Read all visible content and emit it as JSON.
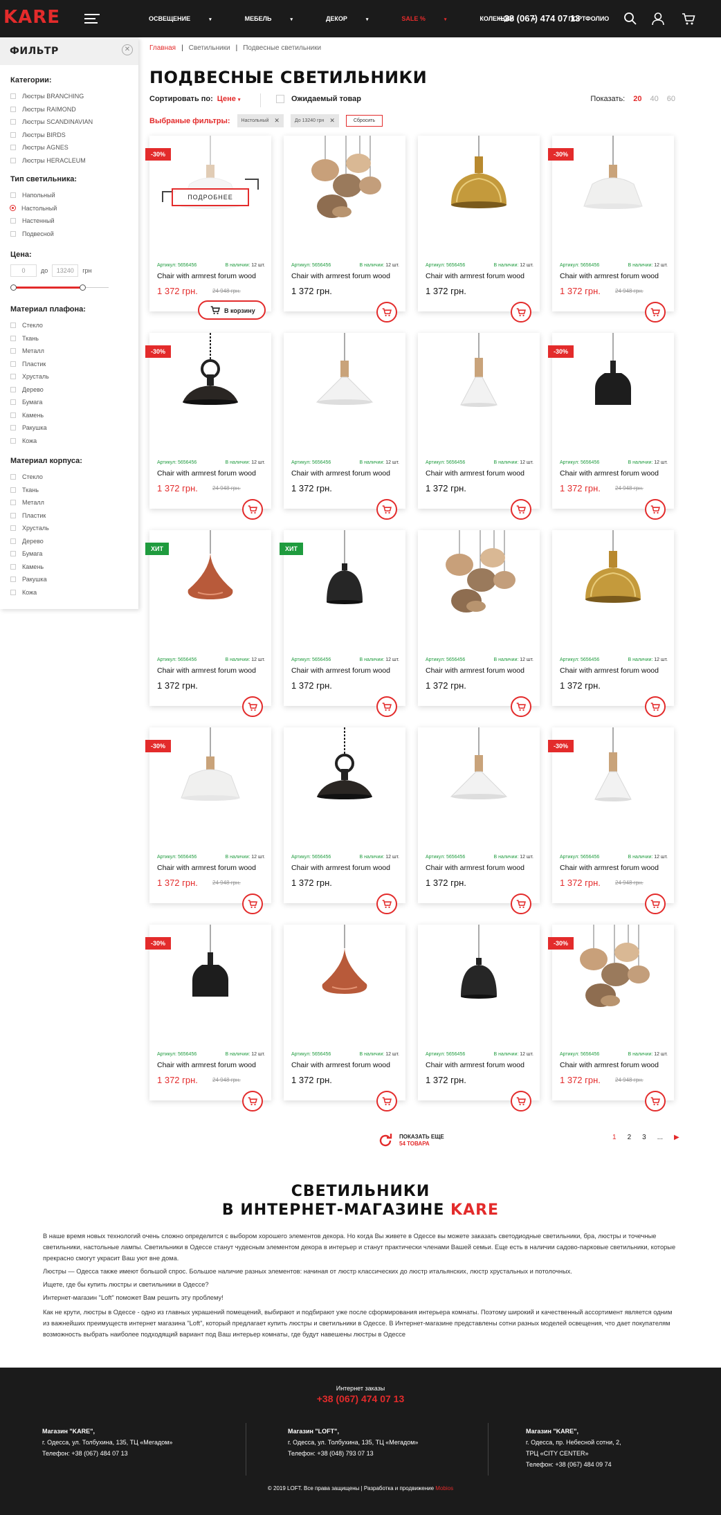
{
  "header": {
    "logo": "KARE",
    "nav": [
      {
        "label": "Освещение",
        "dropdown": true,
        "highlight": false
      },
      {
        "label": "Мебель",
        "dropdown": true,
        "highlight": false
      },
      {
        "label": "Декор",
        "dropdown": true,
        "highlight": false
      },
      {
        "label": "Sale %",
        "dropdown": true,
        "highlight": true
      },
      {
        "label": "Колекции",
        "dropdown": true,
        "highlight": false
      },
      {
        "label": "Портфолио",
        "dropdown": false,
        "highlight": false
      }
    ],
    "phone": "+38 (067) 474 07 13",
    "icons": [
      "search-icon",
      "user-icon",
      "cart-icon"
    ]
  },
  "filter": {
    "title": "ФИЛЬТР",
    "categories": {
      "title": "Категории:",
      "items": [
        "Люстры BRANCHING",
        "Люстры RAIMOND",
        "Люстры SCANDINAVIAN",
        "Люстры BIRDS",
        "Люстры AGNES",
        "Люстры HERACLEUM"
      ]
    },
    "lamp_type": {
      "title": "Тип светильника:",
      "items": [
        "Напольный",
        "Настольный",
        "Настенный",
        "Подвесной"
      ],
      "selected": "Настольный"
    },
    "price": {
      "title": "Цена:",
      "from": "0",
      "to": "13240",
      "to_label": "до",
      "currency": "грн"
    },
    "shade_material": {
      "title": "Материал плафона:",
      "items": [
        "Стекло",
        "Ткань",
        "Металл",
        "Пластик",
        "Хрусталь",
        "Дерево",
        "Бумага",
        "Камень",
        "Ракушка",
        "Кожа"
      ]
    },
    "body_material": {
      "title": "Материал корпуса:",
      "items": [
        "Стекло",
        "Ткань",
        "Металл",
        "Пластик",
        "Хрусталь",
        "Дерево",
        "Бумага",
        "Камень",
        "Ракушка",
        "Кожа"
      ]
    }
  },
  "breadcrumb": [
    "Главная",
    "Светильники",
    "Подвесные светильники"
  ],
  "page_title": "ПОДВЕСНЫЕ СВЕТИЛЬНИКИ",
  "sort": {
    "label": "Сортировать по:",
    "value": "Цене"
  },
  "expected": "Ожидаемый товар",
  "show": {
    "label": "Показать:",
    "options": [
      "20",
      "40",
      "60"
    ],
    "selected": "20"
  },
  "chosen_filters": {
    "label": "Выбраные фильтры:",
    "chips": [
      "Настольный",
      "До 13240 грн"
    ],
    "reset": "Сбросить"
  },
  "product_labels": {
    "sku": "Артикул: 5656456",
    "stock_prefix": "В наличии:",
    "stock_value": "12 шт.",
    "name": "Chair with armrest forum wood",
    "price": "1 372 грн.",
    "old_price": "24 948 грн.",
    "add_to_cart": "В корзину",
    "details": "ПОДРОБНЕЕ"
  },
  "products": [
    {
      "img": "white-bowl",
      "badge": "-30%",
      "sale": true,
      "hover": true
    },
    {
      "img": "amber-blobs",
      "badge": "",
      "sale": false
    },
    {
      "img": "gold-dome",
      "badge": "",
      "sale": false
    },
    {
      "img": "white-bowl",
      "badge": "-30%",
      "sale": true
    },
    {
      "img": "black-industrial",
      "badge": "-30%",
      "sale": true
    },
    {
      "img": "white-cone-wide",
      "badge": "",
      "sale": false
    },
    {
      "img": "white-cone-narrow",
      "badge": "",
      "sale": false
    },
    {
      "img": "black-cylinder",
      "badge": "-30%",
      "sale": true
    },
    {
      "img": "copper-onion",
      "badge": "ХИТ",
      "sale": false,
      "hit": true
    },
    {
      "img": "black-dome",
      "badge": "ХИТ",
      "sale": false,
      "hit": true
    },
    {
      "img": "amber-blobs",
      "badge": "",
      "sale": false
    },
    {
      "img": "gold-dome",
      "badge": "",
      "sale": false
    },
    {
      "img": "white-bowl",
      "badge": "-30%",
      "sale": true
    },
    {
      "img": "black-industrial",
      "badge": "",
      "sale": false
    },
    {
      "img": "white-cone-wide",
      "badge": "",
      "sale": false
    },
    {
      "img": "white-cone-narrow",
      "badge": "-30%",
      "sale": true
    },
    {
      "img": "black-cylinder",
      "badge": "-30%",
      "sale": true
    },
    {
      "img": "copper-onion",
      "badge": "",
      "sale": false
    },
    {
      "img": "black-dome",
      "badge": "",
      "sale": false
    },
    {
      "img": "amber-blobs",
      "badge": "-30%",
      "sale": true
    }
  ],
  "load_more": {
    "line1": "ПОКАЗАТЬ ЕЩЕ",
    "line2": "54 ТОВАРА"
  },
  "pagination": [
    "1",
    "2",
    "3",
    "..."
  ],
  "seo": {
    "title_line1": "СВЕТИЛЬНИКИ",
    "title_line2": "В ИНТЕРНЕТ-МАГАЗИНЕ",
    "title_brand": "KARE",
    "paragraphs": [
      "В наше время новых технологий очень сложно определится с выбором хорошего элементов декора. Но когда Вы живете в Одессе вы можете заказать светодиодные светильники, бра, люстры и точечные светильники, настольные лампы. Светильники в Одессе станут чудесным элементом декора в интерьер и станут практически членами Вашей семьи. Еще есть в наличии садово-парковые светильники, которые прекрасно смогут украсит Ваш уют вне дома.",
      "Люстры — Одесса также имеют большой спрос. Большое наличие разных элементов: начиная от люстр классических до люстр итальянских, люстр хрустальных и потолочных.",
      "Ищете, где бы купить люстры и светильники в Одессе?",
      "Интернет-магазин \"Loft\" поможет Вам решить эту проблему!",
      "Как не крути, люстры в Одессе - одно из главных украшений помещений, выбирают и подбирают уже после сформирования интерьера комнаты. Поэтому широкий и качественный ассортимент является одним из важнейших преимуществ интернет магазина \"Loft\", который предлагает купить люстры и светильники в Одессе. В Интернет-магазине представлены сотни разных моделей освещения, что дает покупателям возможность выбрать наиболее подходящий вариант под Ваш интерьер комнаты, где будут навешены люстры в Одессе"
    ]
  },
  "footer": {
    "orders_label": "Интернет заказы",
    "orders_phone": "+38 (067) 474 07 13",
    "stores": [
      {
        "name": "Магазин \"KARE\",",
        "lines": [
          "г. Одесса, ул. Толбухина, 135, ТЦ «Мегадом»",
          "Телефон: +38 (067) 484 07 13"
        ]
      },
      {
        "name": "Магазин \"LOFT\",",
        "lines": [
          "г. Одесса, ул. Толбухина, 135, ТЦ «Мегадом»",
          "Телефон: +38 (048) 793 07 13"
        ]
      },
      {
        "name": "Магазин \"KARE\",",
        "lines": [
          "г. Одесса, пр. Небесной сотни, 2,",
          "ТРЦ «CITY CENTER»",
          "Телефон: +38 (067) 484 09 74"
        ]
      }
    ],
    "copyright": "© 2019 LOFT. Все права защищены | Разработка и продвижение",
    "developer": "Mobios"
  },
  "colors": {
    "accent": "#e32b2b",
    "hit": "#1f9b3e",
    "dark": "#1b1b1b"
  }
}
